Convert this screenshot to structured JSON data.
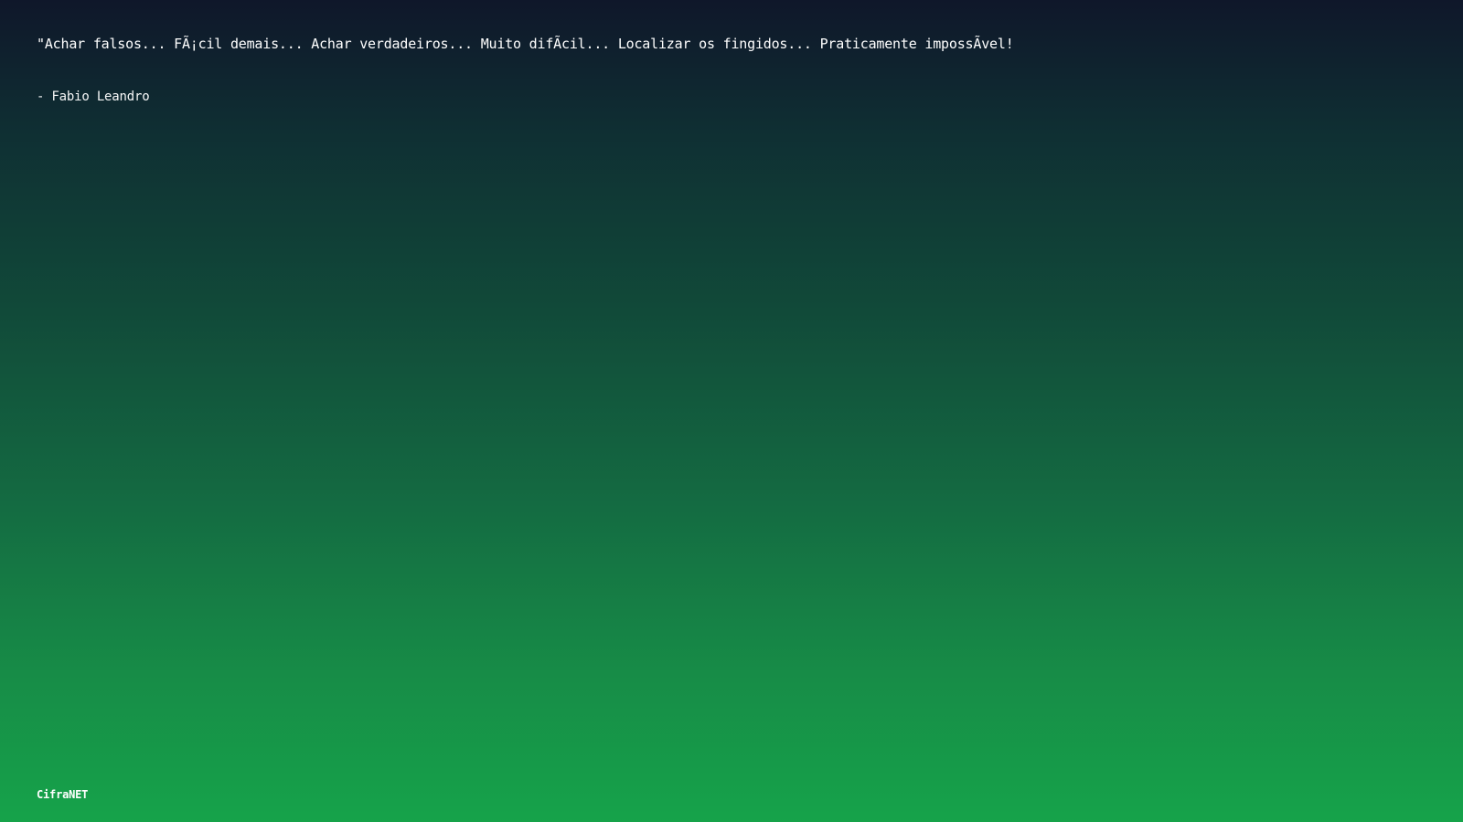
{
  "quote": {
    "text": "\"Achar falsos... FÃ¡cil demais... Achar verdadeiros... Muito difÃ­cil... Localizar os fingidos... Praticamente impossÃ­vel!",
    "author": "- Fabio Leandro"
  },
  "brand": {
    "label": "CifraNET"
  },
  "colors": {
    "background_top": "#0f172a",
    "background_bottom": "#16a34a",
    "text": "#ffffff"
  }
}
